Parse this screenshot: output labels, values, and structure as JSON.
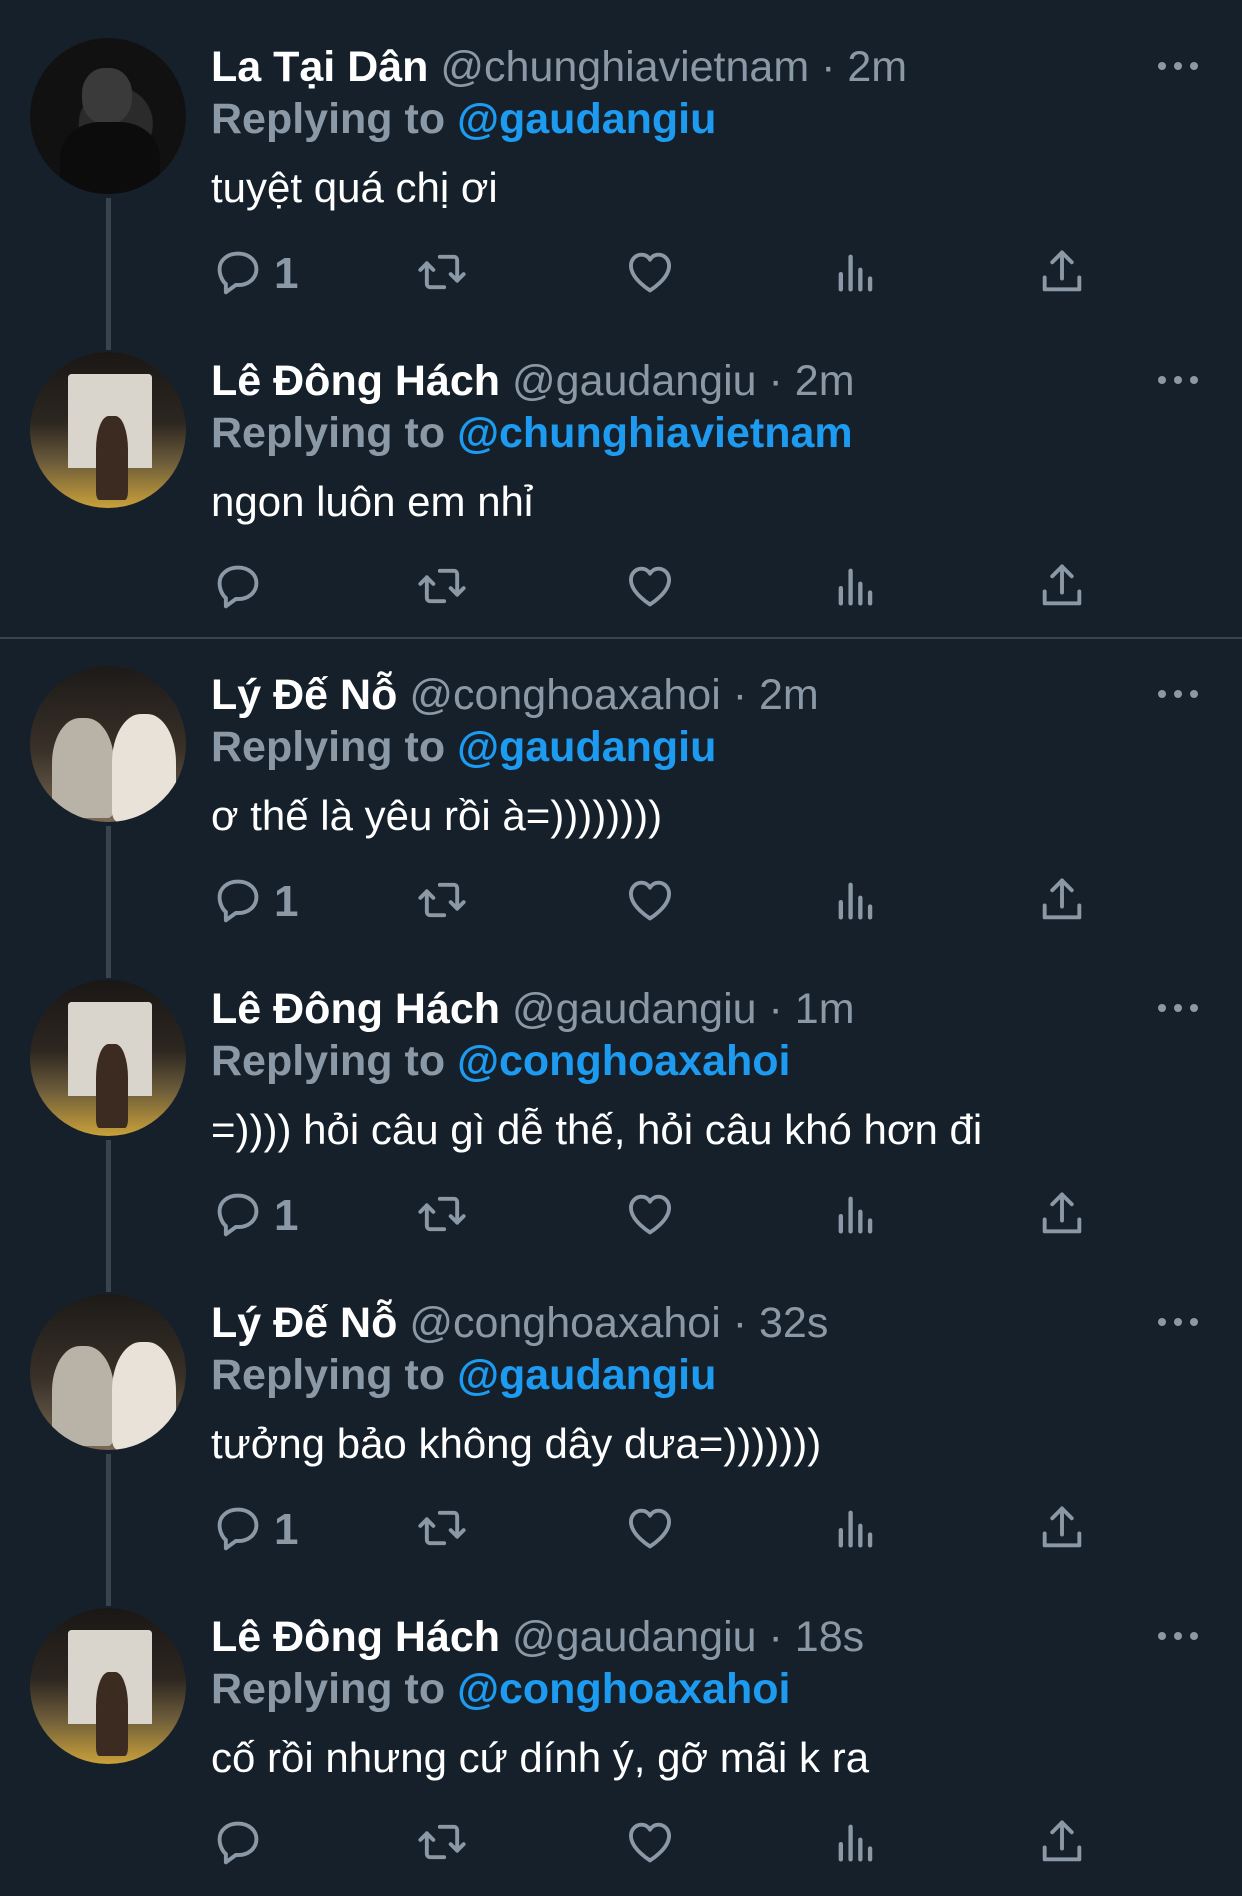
{
  "replying_label": "Replying to",
  "tweets": [
    {
      "name": "La Tại Dân",
      "handle": "@chunghiavietnam",
      "time": "· 2m",
      "replying_to": "@gaudangiu",
      "text": "tuyệt quá chị ơi",
      "reply_count": "1",
      "avatar": "person-night-portrait"
    },
    {
      "name": "Lê Đông Hách",
      "handle": "@gaudangiu",
      "time": "· 2m",
      "replying_to": "@chunghiavietnam",
      "text": "ngon luôn em nhỉ",
      "reply_count": "",
      "avatar": "arc-de-triomphe-photo"
    },
    {
      "name": "Lý Đế Nỗ",
      "handle": "@conghoaxahoi",
      "time": "· 2m",
      "replying_to": "@gaudangiu",
      "text": "ơ thế là yêu rồi à=))))))))",
      "reply_count": "1",
      "avatar": "two-people-louvre-photo"
    },
    {
      "name": "Lê Đông Hách",
      "handle": "@gaudangiu",
      "time": "· 1m",
      "replying_to": "@conghoaxahoi",
      "text": "=)))) hỏi câu gì dễ thế, hỏi câu khó hơn đi",
      "reply_count": "1",
      "avatar": "arc-de-triomphe-photo"
    },
    {
      "name": "Lý Đế Nỗ",
      "handle": "@conghoaxahoi",
      "time": "· 32s",
      "replying_to": "@gaudangiu",
      "text": "tưởng bảo không dây dưa=)))))))",
      "reply_count": "1",
      "avatar": "two-people-louvre-photo"
    },
    {
      "name": "Lê Đông Hách",
      "handle": "@gaudangiu",
      "time": "· 18s",
      "replying_to": "@conghoaxahoi",
      "text": "cố rồi nhưng cứ dính ý, gỡ mãi k ra",
      "reply_count": "",
      "avatar": "arc-de-triomphe-photo"
    }
  ],
  "colors": {
    "background": "#15202b",
    "secondary_text": "#8b98a5",
    "link": "#1d9bf0",
    "divider": "#38444d"
  },
  "icons": [
    "reply-icon",
    "retweet-icon",
    "like-icon",
    "views-icon",
    "share-icon",
    "more-icon"
  ]
}
